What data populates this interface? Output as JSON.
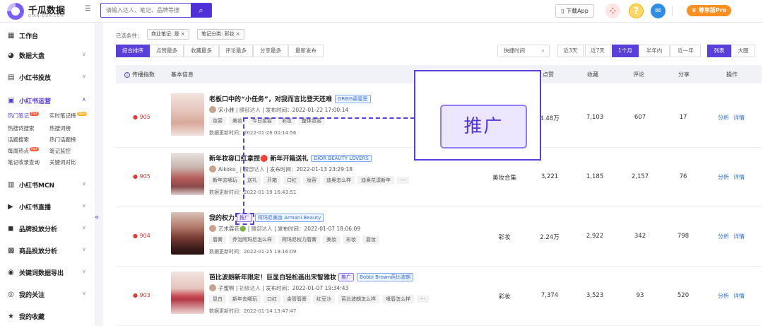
{
  "header": {
    "logo_name": "千瓜数据",
    "logo_sub": "QIAN-GUA.COM",
    "search_placeholder": "请输入达人、笔记、品牌等搜",
    "download_label": "下载App",
    "pro_label": "尊享版Pro"
  },
  "sidebar": {
    "items": [
      {
        "label": "工作台",
        "icon": "grid-icon"
      },
      {
        "label": "数据大盘",
        "icon": "pie-icon"
      },
      {
        "label": "小红书投放",
        "icon": "table-icon"
      },
      {
        "label": "小红书运营",
        "icon": "chart-icon"
      },
      {
        "label": "小红书MCN",
        "icon": "mcn-icon"
      },
      {
        "label": "小红书直播",
        "icon": "video-icon"
      },
      {
        "label": "品牌投放分析",
        "icon": "bag-icon"
      },
      {
        "label": "商品投放分析",
        "icon": "box-icon"
      },
      {
        "label": "关键词数据导出",
        "icon": "export-icon"
      },
      {
        "label": "我的关注",
        "icon": "eye-icon"
      },
      {
        "label": "我的收藏",
        "icon": "star-icon"
      }
    ],
    "subitems": [
      "热门笔记",
      "实时笔记榜",
      "热搜词搜索",
      "热搜词榜",
      "话题搜索",
      "热门话题榜",
      "每周热点",
      "笔记监控",
      "笔记收录查询",
      "关键词对比"
    ],
    "hot_badge": "Hot",
    "new_badge": "New"
  },
  "filters": {
    "label": "已选条件：",
    "chips": [
      "商业笔记: 是 ×",
      "笔记分类: 彩妆 ×"
    ]
  },
  "sort_buttons": [
    "综合排序",
    "点赞最多",
    "收藏最多",
    "评论最多",
    "分享最多",
    "最新发布"
  ],
  "quick_time": "快捷时间",
  "time_buttons": [
    "近3天",
    "近7天",
    "1个月",
    "半年内",
    "近一年"
  ],
  "view_buttons": [
    "列表",
    "大图"
  ],
  "table": {
    "headers": {
      "index": "传播指数",
      "info": "基本信息",
      "like": "点赞",
      "collect": "收藏",
      "comment": "评论",
      "share": "分享",
      "ops": "操作"
    },
    "update_prefix": "数据更新时间：",
    "ops": [
      "分析",
      "详情"
    ],
    "rows": [
      {
        "index": "905",
        "title": "老板口中的“小任务”，对我而言比登天还难",
        "brand": "ORBIS奥蜜思",
        "author": "宋小雅",
        "level": "腰部达人",
        "published": "发布时间：2022-01-22 17:00:14",
        "tags": [
          "妆容",
          "美妆",
          "今日妆容",
          "彩妆",
          "整体妆容"
        ],
        "updated": "2022-01-26 00:14:56",
        "category": "",
        "like": "4.48万",
        "collect": "7,103",
        "comment": "607",
        "share": "17"
      },
      {
        "index": "905",
        "title": "新年妆容口红拿捏🔴 新年开箱送礼",
        "brand": "DIOR BEAUTY LOVERS",
        "author": "Aikoko_",
        "level": "腰部达人",
        "published": "发布时间：2022-01-13 23:29:18",
        "tags": [
          "新年去哪玩",
          "送礼",
          "开箱",
          "口红",
          "妆容",
          "迪奥怎么样",
          "迪奥花漾新年",
          "···"
        ],
        "updated": "2022-01-19 16:43:51",
        "category": "美妆合集",
        "like": "3,221",
        "collect": "1,185",
        "comment": "2,157",
        "share": "76"
      },
      {
        "index": "904",
        "title": "我的权力",
        "promo": "推广",
        "brand": "阿玛尼美妆 Armani Beauty",
        "author": "艺术霖花🟢",
        "level": "腰部达人",
        "published": "发布时间：2022-01-07 18:06:09",
        "tags": [
          "唇膏",
          "乔治阿玛尼怎么样",
          "阿玛尼权力唇膏",
          "美妆",
          "彩妆",
          "唇妆"
        ],
        "updated": "2022-01-25 19:16:09",
        "category": "彩妆",
        "like": "2.24万",
        "collect": "2,922",
        "comment": "342",
        "share": "798"
      },
      {
        "index": "903",
        "title": "芭比波朗新年限定！巨显白轻松画出宋智雅妆",
        "promo": "推广",
        "brand": "Bobbi Brown芭比波朗",
        "author": "子蜜啊",
        "level": "初级达人",
        "published": "发布时间：2022-01-07 19:34:43",
        "tags": [
          "显白",
          "新年去哪玩",
          "口红",
          "金管唇膏",
          "红豆沙",
          "芭比波朗怎么样",
          "嗜唇怎么样",
          "···"
        ],
        "updated": "2022-01-14 13:47:47",
        "category": "彩妆",
        "like": "7,374",
        "collect": "3,523",
        "comment": "93",
        "share": "520"
      }
    ]
  },
  "zoom_label": "推广",
  "colors": {
    "accent": "#5b3fdb",
    "link": "#2e6fe6",
    "orange": "#ff8f1f",
    "fire": "#e03a3a"
  }
}
